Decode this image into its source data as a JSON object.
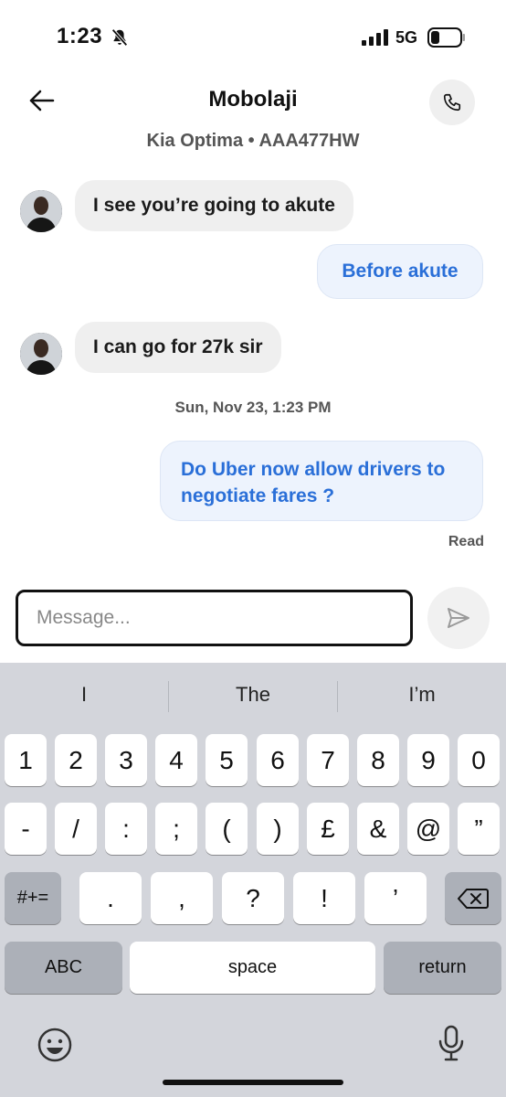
{
  "status": {
    "time": "1:23",
    "network": "5G"
  },
  "header": {
    "contact_name": "Mobolaji",
    "vehicle": "Kia Optima • AAA477HW"
  },
  "messages": [
    {
      "from": "driver",
      "text": "I see you’re going to akute"
    },
    {
      "from": "me",
      "text": "Before akute"
    },
    {
      "from": "driver",
      "text": "I can go for 27k sir"
    },
    {
      "from": "me",
      "text": "Do Uber now allow drivers to negotiate fares ?"
    }
  ],
  "timestamp": "Sun, Nov 23, 1:23 PM",
  "read_receipt": "Read",
  "composer": {
    "placeholder": "Message..."
  },
  "keyboard": {
    "suggestions": [
      "I",
      "The",
      "I’m"
    ],
    "row1": [
      "1",
      "2",
      "3",
      "4",
      "5",
      "6",
      "7",
      "8",
      "9",
      "0"
    ],
    "row2": [
      "-",
      "/",
      ":",
      ";",
      "(",
      ")",
      "£",
      "&",
      "@",
      "”"
    ],
    "row3": [
      "#+=",
      ".",
      ",",
      "?",
      "!",
      "’"
    ],
    "abc_label": "ABC",
    "space_label": "space",
    "return_label": "return"
  },
  "icons": {
    "mute": "bell-slash-icon",
    "signal": "signal-bars-icon",
    "battery": "battery-icon",
    "back": "back-arrow-icon",
    "call": "phone-icon",
    "send": "send-icon",
    "delete": "backspace-icon",
    "emoji": "emoji-icon",
    "dictation": "microphone-icon"
  }
}
